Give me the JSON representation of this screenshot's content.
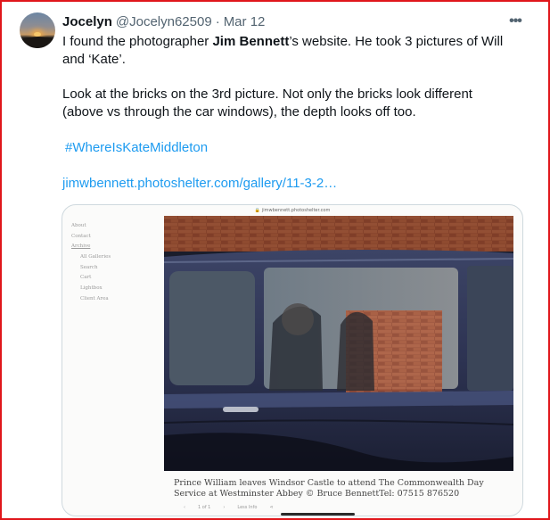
{
  "tweet": {
    "author_name": "Jocelyn",
    "handle": "@Jocelyn62509",
    "separator": "·",
    "date": "Mar 12",
    "more_icon": "more-horizontal-icon",
    "text": {
      "line1_pre": "I found the photographer ",
      "line1_bold": "Jim Bennett",
      "line1_post": "’s website. He took 3 pictures of Will",
      "line2": "and ‘Kate’.",
      "para2_line1": "Look at the bricks on the 3rd picture. Not only the bricks look different",
      "para2_line2": "(above vs through the car windows), the depth looks off too.",
      "hashtag": "#WhereIsKateMiddleton",
      "url": "jimwbennett.photoshelter.com/gallery/11-3-2…"
    }
  },
  "card": {
    "site_url": "jimwbennett.photoshelter.com",
    "sidebar": [
      "About",
      "Contact",
      "Archive",
      "All Galleries",
      "Search",
      "Cart",
      "Lightbox",
      "Client Area"
    ],
    "caption": "Prince William leaves Windsor Castle to attend The Commonwealth Day Service at Westminster Abbey © Bruce BennettTel: 07515 876520",
    "pager_count": "1 of 1",
    "pager_info": "Less Info"
  },
  "colors": {
    "accent": "#1d9bf0",
    "frame": "#e0161b",
    "muted": "#536471"
  }
}
